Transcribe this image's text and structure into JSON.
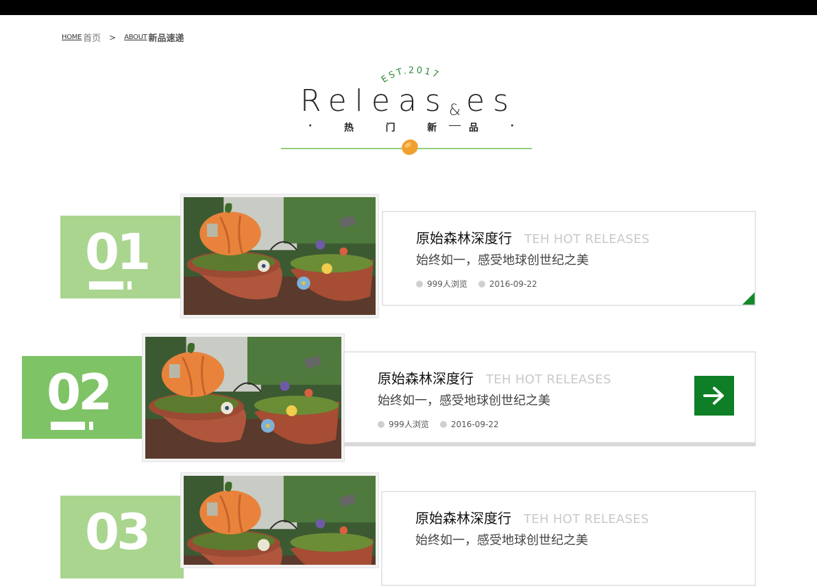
{
  "breadcrumb": {
    "home_en": "HOME",
    "home_cn": "首页",
    "separator": ">",
    "about_en": "ABOUT",
    "about_cn": "新品速递"
  },
  "heading": {
    "est": "EST.2017",
    "title_start": "Releas",
    "title_amp": "&",
    "title_end": "es",
    "sub_chars": [
      "·",
      "热",
      "门",
      "新",
      "品",
      "·"
    ]
  },
  "colors": {
    "accent_green": "#0e7f26",
    "light_green": "#a9d58f",
    "mid_green": "#7ec366",
    "line_green": "#8fce7a",
    "leaf_orange": "#f0a030"
  },
  "items": [
    {
      "number": "01",
      "title_cn": "原始森林深度行",
      "title_en": "TEH HOT RELEASES",
      "description": "始终如一，感受地球创世纪之美",
      "views": "999人浏览",
      "date": "2016-09-22",
      "image_icon": "pumpkin-garden-photo"
    },
    {
      "number": "02",
      "title_cn": "原始森林深度行",
      "title_en": "TEH HOT RELEASES",
      "description": "始终如一，感受地球创世纪之美",
      "views": "999人浏览",
      "date": "2016-09-22",
      "image_icon": "pumpkin-garden-photo",
      "arrow_icon": "arrow-right-icon"
    },
    {
      "number": "03",
      "title_cn": "原始森林深度行",
      "title_en": "TEH HOT RELEASES",
      "description": "始终如一，感受地球创世纪之美",
      "image_icon": "pumpkin-garden-photo"
    }
  ]
}
